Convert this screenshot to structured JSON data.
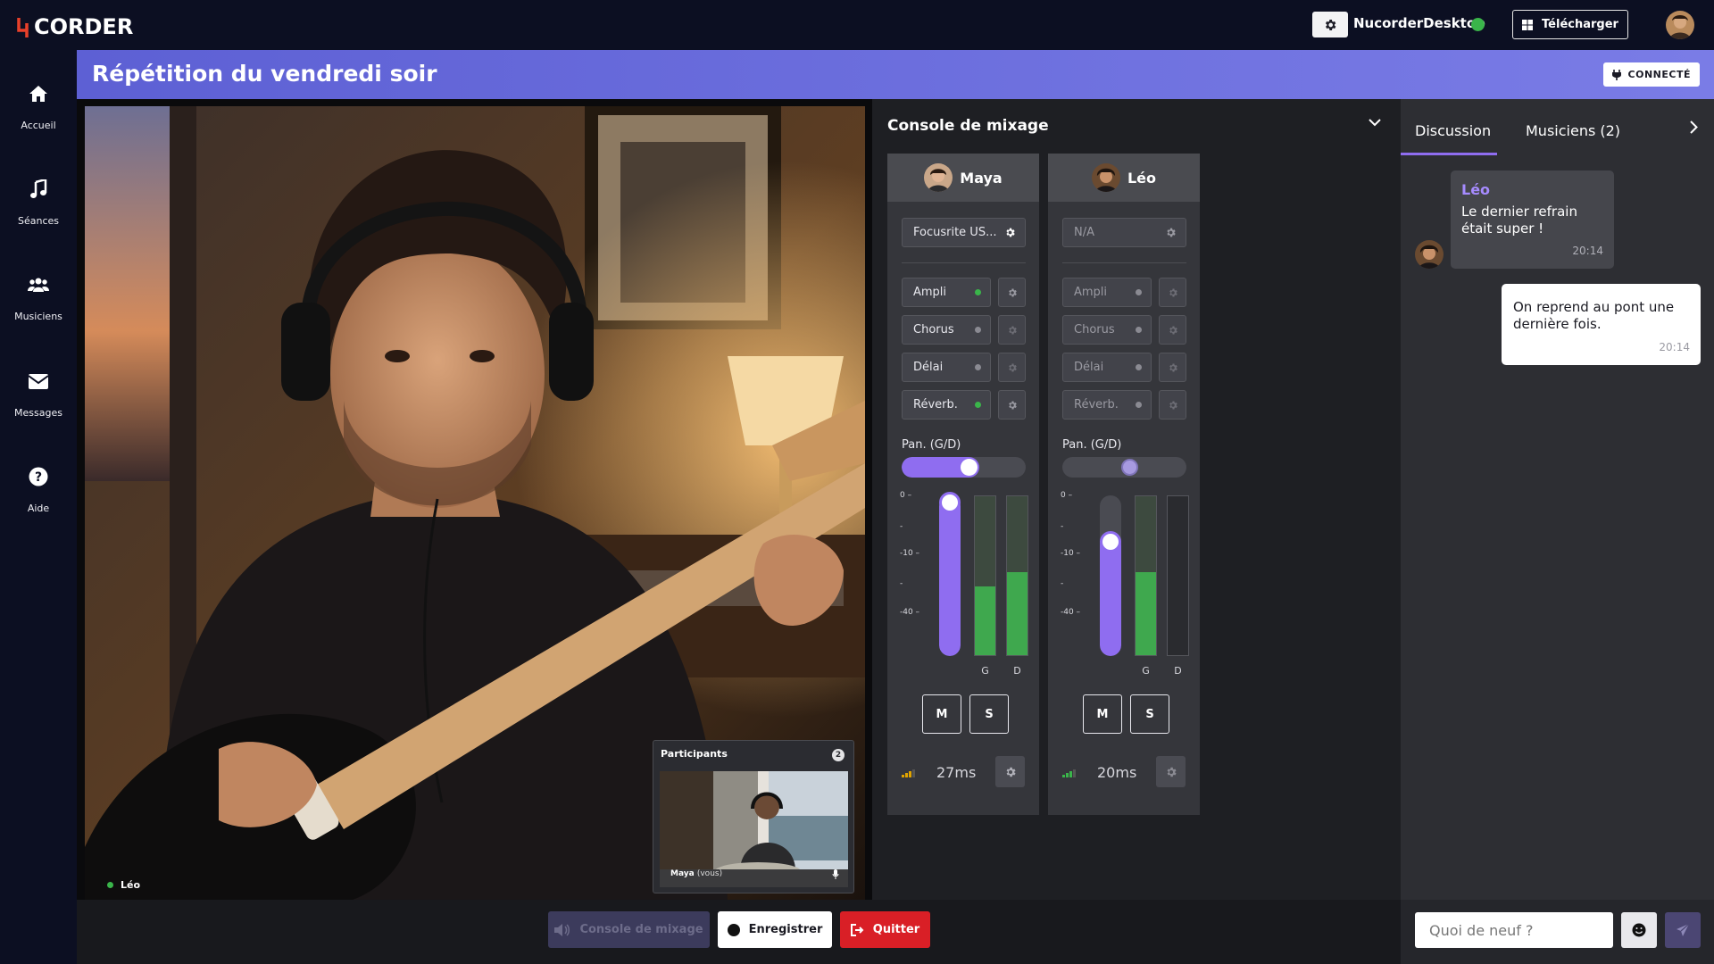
{
  "app": {
    "logo_text": "CORDER"
  },
  "topbar": {
    "desktop_name": "NucorderDesktop",
    "download_label": "Télécharger"
  },
  "sidebar": {
    "items": [
      {
        "label": "Accueil",
        "icon": "home-icon"
      },
      {
        "label": "Séances",
        "icon": "music-note-icon"
      },
      {
        "label": "Musiciens",
        "icon": "users-icon"
      },
      {
        "label": "Messages",
        "icon": "envelope-icon"
      },
      {
        "label": "Aide",
        "icon": "help-icon"
      }
    ]
  },
  "session": {
    "title": "Répétition du vendredi soir",
    "status": "CONNECTÉ"
  },
  "video": {
    "main_label": "Léo",
    "participants_title": "Participants",
    "participants_count": "2",
    "thumb_name": "Maya",
    "thumb_suffix": "(vous)"
  },
  "mixer": {
    "title": "Console de mixage",
    "pan_label": "Pan. (G/D)",
    "db_ticks": [
      "0 –",
      "-",
      "-10 –",
      "-",
      "-40 –"
    ],
    "meter_left": "G",
    "meter_right": "D",
    "mute": "M",
    "solo": "S",
    "channels": [
      {
        "name": "Maya",
        "device": "Focusrite US...",
        "effects": [
          {
            "label": "Ampli",
            "on": true
          },
          {
            "label": "Chorus",
            "on": false
          },
          {
            "label": "Délai",
            "on": false
          },
          {
            "label": "Réverb.",
            "on": true
          }
        ],
        "pan": 0.5,
        "fader": 1.0,
        "meter_g": 0.43,
        "meter_d": 0.52,
        "latency": "27ms"
      },
      {
        "name": "Léo",
        "device": "N/A",
        "effects": [
          {
            "label": "Ampli",
            "on": false
          },
          {
            "label": "Chorus",
            "on": false
          },
          {
            "label": "Délai",
            "on": false
          },
          {
            "label": "Réverb.",
            "on": false
          }
        ],
        "pan": 0.5,
        "fader": 0.72,
        "meter_g": 0.52,
        "meter_d": 0.0,
        "latency": "20ms"
      }
    ]
  },
  "chat": {
    "tab_discussion": "Discussion",
    "tab_musicians": "Musiciens (2)",
    "messages": [
      {
        "author": "Léo",
        "text": "Le dernier refrain était super !",
        "time": "20:14"
      },
      {
        "author": "",
        "text": "On reprend au pont une dernière fois.",
        "time": "20:14"
      }
    ],
    "input_placeholder": "Quoi de neuf ?"
  },
  "bottom": {
    "mixer_label": "Console de mixage",
    "record_label": "Enregistrer",
    "quit_label": "Quitter"
  },
  "colors": {
    "accent": "#8f6df0",
    "banner_start": "#5d60d4",
    "live_green": "#3ab54a",
    "quit_red": "#d91f26"
  }
}
